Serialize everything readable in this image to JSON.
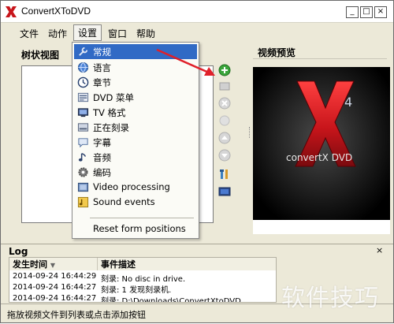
{
  "window": {
    "title": "ConvertXToDVD",
    "minimize": "_",
    "maximize": "□",
    "close": "×"
  },
  "menubar": {
    "items": [
      "文件",
      "动作",
      "设置",
      "窗口",
      "帮助"
    ],
    "active_index": 2
  },
  "left_panel": {
    "title": "树状视图"
  },
  "preview": {
    "title": "视频预览",
    "brand": "convertX DVD",
    "version": "4"
  },
  "settings_menu": {
    "items": [
      {
        "label": "常规",
        "icon": "wrench-icon",
        "selected": true
      },
      {
        "label": "语言",
        "icon": "globe-icon"
      },
      {
        "label": "章节",
        "icon": "clock-icon"
      },
      {
        "label": "DVD 菜单",
        "icon": "dvd-menu-icon"
      },
      {
        "label": "TV 格式",
        "icon": "tv-icon"
      },
      {
        "label": "正在刻录",
        "icon": "burn-icon"
      },
      {
        "label": "字幕",
        "icon": "subtitle-icon"
      },
      {
        "label": "音频",
        "icon": "music-note-icon"
      },
      {
        "label": "编码",
        "icon": "gear-icon"
      },
      {
        "label": "Video processing",
        "icon": "video-processing-icon"
      },
      {
        "label": "Sound events",
        "icon": "sound-events-icon"
      }
    ],
    "footer_item": "Reset form positions"
  },
  "log": {
    "title": "Log",
    "close": "×",
    "columns": [
      "发生时间",
      "事件描述"
    ],
    "rows": [
      {
        "time": "2014-09-24 16:44:29",
        "event": "刻录: No disc in drive."
      },
      {
        "time": "2014-09-24 16:44:27",
        "event": "刻录: 1 发现刻录机."
      },
      {
        "time": "2014-09-24 16:44:27",
        "event": "刻录: D:\\Downloads\\ConvertXtoDVD..."
      }
    ]
  },
  "status_bar": {
    "text": "拖放视频文件到列表或点击添加按钮"
  },
  "watermark": "软件技巧",
  "colors": {
    "menu_highlight": "#316ac5",
    "arrow": "#e0202a",
    "brand_red": "#c8151b",
    "window_bg": "#ece9d8"
  }
}
